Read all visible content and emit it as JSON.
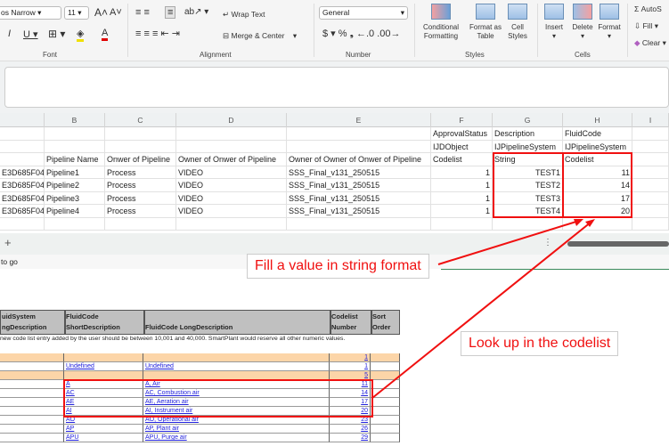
{
  "ribbon": {
    "font_name": "os Narrow",
    "font_size": "11",
    "font_group": "Font",
    "alignment_group": "Alignment",
    "number_group": "Number",
    "styles_group": "Styles",
    "cells_group": "Cells",
    "wrap_text": "Wrap Text",
    "merge_center": "Merge & Center",
    "number_format": "General",
    "conditional_formatting": [
      "Conditional",
      "Formatting"
    ],
    "format_as_table": [
      "Format as",
      "Table"
    ],
    "cell_styles": [
      "Cell",
      "Styles"
    ],
    "insert": "Insert",
    "delete": "Delete",
    "format": "Format",
    "autosum": "AutoS",
    "fill": "Fill",
    "clear": "Clear"
  },
  "columns": [
    "B",
    "C",
    "D",
    "E",
    "F",
    "G",
    "H",
    "I"
  ],
  "header_rows": [
    {
      "F": "ApprovalStatus",
      "G": "Description",
      "H": "FluidCode"
    },
    {
      "F": "IJDObject",
      "G": "IJPipelineSystem",
      "H": "IJPipelineSystem"
    },
    {
      "B": "Pipeline Name",
      "C": "Onwer of Pipeline",
      "D": "Owner of Onwer of Pipeline",
      "E": "Owner of Owner of Onwer of Pipeline",
      "F": "Codelist",
      "G": "String",
      "H": "Codelist"
    }
  ],
  "rows": [
    {
      "A": "E3D685F04",
      "B": "Pipeline1",
      "C": "Process",
      "D": "VIDEO",
      "E": "SSS_Final_v131_250515",
      "F": "1",
      "G": "TEST1",
      "H": "11"
    },
    {
      "A": "E3D685F04",
      "B": "Pipeline2",
      "C": "Process",
      "D": "VIDEO",
      "E": "SSS_Final_v131_250515",
      "F": "1",
      "G": "TEST2",
      "H": "14"
    },
    {
      "A": "E3D685F04",
      "B": "Pipeline3",
      "C": "Process",
      "D": "VIDEO",
      "E": "SSS_Final_v131_250515",
      "F": "1",
      "G": "TEST3",
      "H": "17"
    },
    {
      "A": "E3D685F04",
      "B": "Pipeline4",
      "C": "Process",
      "D": "VIDEO",
      "E": "SSS_Final_v131_250515",
      "F": "1",
      "G": "TEST4",
      "H": "20"
    }
  ],
  "tabbar": {
    "add": "+",
    "menu": "⋮"
  },
  "status": {
    "text": "to go"
  },
  "callouts": {
    "string": "Fill a value in string format",
    "codelist": "Look up in the codelist"
  },
  "codelist": {
    "headers": [
      [
        "uidSystem",
        "ngDescription"
      ],
      [
        "FluidCode",
        "ShortDescription"
      ],
      [
        "",
        "FluidCode LongDescription"
      ],
      [
        "Codelist",
        "Number"
      ],
      [
        "Sort",
        "Order"
      ]
    ],
    "note": "new code list entry added by the user should be between 10,001 and 40,000. SmartPlant would reserve all other numeric values.",
    "rows": [
      {
        "short": "",
        "long": "",
        "num": "1",
        "orange": true
      },
      {
        "short": "Undefined",
        "long": "Undefined",
        "num": "1",
        "orange": false
      },
      {
        "short": "",
        "long": "",
        "num": "5",
        "orange": true
      },
      {
        "short": "A",
        "long": "A, Air",
        "num": "11",
        "orange": false
      },
      {
        "short": "AC",
        "long": "AC, Combustion air",
        "num": "14",
        "orange": false
      },
      {
        "short": "AE",
        "long": "AE, Aeration air",
        "num": "17",
        "orange": false
      },
      {
        "short": "AI",
        "long": "AI, Instrument air",
        "num": "20",
        "orange": false
      },
      {
        "short": "AO",
        "long": "AO, Operational air",
        "num": "23",
        "orange": false
      },
      {
        "short": "AP",
        "long": "AP, Plant air",
        "num": "26",
        "orange": false
      },
      {
        "short": "APU",
        "long": "APU, Purge air",
        "num": "29",
        "orange": false
      }
    ]
  },
  "colors": {
    "accent": "#f01010",
    "orange": "#fcd5a8",
    "header_gray": "#c0c0c0"
  }
}
